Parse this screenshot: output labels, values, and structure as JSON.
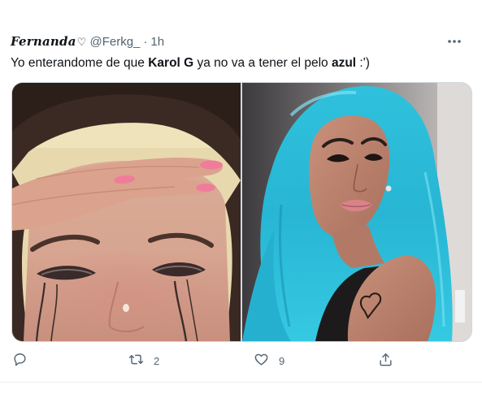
{
  "tweet": {
    "display_name": "Fernanda",
    "name_suffix": "♡",
    "handle": "@Ferkg_",
    "separator": "·",
    "time": "1h",
    "text_parts": [
      {
        "text": "Yo enterandome de que ",
        "bold": false
      },
      {
        "text": "Karol G",
        "bold": true
      },
      {
        "text": " ya no va a tener el pelo ",
        "bold": false
      },
      {
        "text": "azul",
        "bold": true
      },
      {
        "text": " :')",
        "bold": false
      }
    ]
  },
  "actions": {
    "reply_icon": "reply-icon",
    "retweet_icon": "retweet-icon",
    "retweet_count": "2",
    "like_icon": "heart-icon",
    "like_count": "9",
    "share_icon": "share-icon"
  },
  "colors": {
    "text": "#0f1419",
    "secondary": "#536471",
    "border": "#cfd9de",
    "hair_blue": "#2ec3dd"
  }
}
